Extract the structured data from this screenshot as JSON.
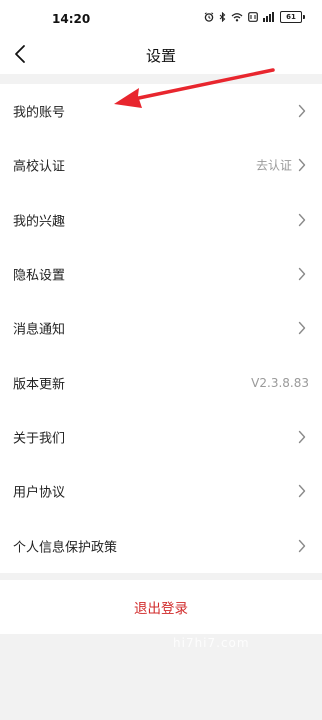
{
  "status_bar": {
    "time": "14:20",
    "battery": "61",
    "icons": [
      "alarm-icon",
      "bluetooth-icon",
      "wifi-icon",
      "data-icon",
      "signal-icon",
      "battery-icon"
    ]
  },
  "nav": {
    "title": "设置",
    "back_icon": "chevron-left-icon"
  },
  "settings": [
    {
      "label": "我的账号",
      "value": "",
      "chevron": true
    },
    {
      "label": "高校认证",
      "value": "去认证",
      "chevron": true
    },
    {
      "label": "我的兴趣",
      "value": "",
      "chevron": true
    },
    {
      "label": "隐私设置",
      "value": "",
      "chevron": true
    },
    {
      "label": "消息通知",
      "value": "",
      "chevron": true
    },
    {
      "label": "版本更新",
      "value": "V2.3.8.83",
      "chevron": false
    },
    {
      "label": "关于我们",
      "value": "",
      "chevron": true
    },
    {
      "label": "用户协议",
      "value": "",
      "chevron": true
    },
    {
      "label": "个人信息保护政策",
      "value": "",
      "chevron": true
    }
  ],
  "logout": {
    "label": "退出登录"
  },
  "colors": {
    "background": "#f2f2f2",
    "accent_red": "#d12b2b",
    "annotation_arrow": "#e8262e"
  },
  "watermark": "hi7hi7.com"
}
